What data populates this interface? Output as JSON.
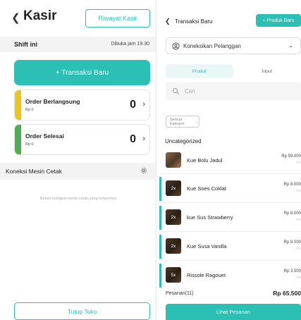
{
  "kasir": {
    "title": "Kasir",
    "riwayat_button": "Riwayat Kasir",
    "shift_label": "Shift ini",
    "shift_time": "Dibuka jam 19.30",
    "new_transaction_button": "+ Transaksi Baru",
    "cards": [
      {
        "title": "Order Berlangsung",
        "amount": "Rp 0",
        "count": "0",
        "color": "#f0c419"
      },
      {
        "title": "Order Selesai",
        "amount": "Rp 0",
        "count": "0",
        "color": "#4caf50"
      }
    ],
    "printer_label": "Koneksi Mesin Cetak",
    "printer_empty": "Belum terdapat mesin cetak yang terkoneksi",
    "close_button": "Tutup Toko"
  },
  "transaksi": {
    "title": "Transaksi Baru",
    "new_product_button": "+ Produk Baru",
    "customer_placeholder": "Koneksikan Pelanggan",
    "tabs": [
      "Produk",
      "Input"
    ],
    "search_placeholder": "Cari",
    "category_filter": "Semua Kategori",
    "category_heading": "Uncategorized",
    "products": [
      {
        "name": "Kue Bolu Jadul",
        "price": "Rp 59.000",
        "stock": "/Pc",
        "qty": ""
      },
      {
        "name": "Kue Soes Coklat",
        "price": "Rp 8.000",
        "stock": "/Pc",
        "qty": "2x"
      },
      {
        "name": "kue Sus Strawberry",
        "price": "Rp 8.000",
        "stock": "/Pc",
        "qty": "2x"
      },
      {
        "name": "Kue Susa Vanilla",
        "price": "Rp 8.000",
        "stock": "/Pc",
        "qty": "2x"
      },
      {
        "name": "Rissole Ragouet",
        "price": "Rp 3.500",
        "stock": "/Pc",
        "qty": "5x"
      }
    ],
    "order_count": "Pesanan(11)",
    "order_total": "Rp 65.500",
    "view_order_button": "Lihat Pesanan"
  },
  "colors": {
    "accent": "#2cc0b5"
  }
}
